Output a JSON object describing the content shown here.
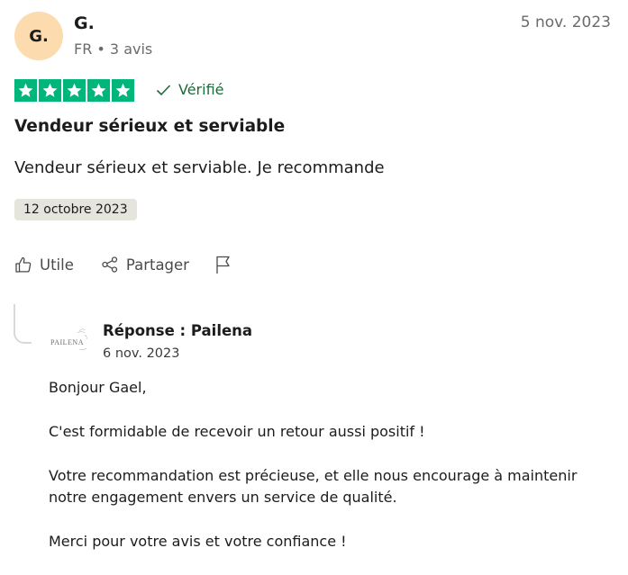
{
  "review": {
    "avatar_initials": "G.",
    "author_name": "G.",
    "author_meta": "FR • 3 avis",
    "date": "5 nov. 2023",
    "rating": 5,
    "verified_label": "Vérifié",
    "title": "Vendeur sérieux et serviable",
    "text": "Vendeur sérieux et serviable. Je recommande",
    "experience_date": "12 octobre 2023"
  },
  "actions": {
    "useful_label": "Utile",
    "share_label": "Partager"
  },
  "reply": {
    "logo_text": "PAILENA",
    "company": "Réponse : Pailena",
    "date": "6 nov. 2023",
    "paragraphs": [
      "Bonjour Gael,",
      "C'est formidable de recevoir un retour aussi positif !",
      "Votre recommandation est précieuse, et elle nous encourage à maintenir notre engagement envers un service de qualité.",
      "Merci pour votre avis et votre confiance !"
    ]
  },
  "colors": {
    "star_green": "#00b67a",
    "verified_green": "#1c6b3a",
    "avatar_bg": "#fcdcaf"
  }
}
